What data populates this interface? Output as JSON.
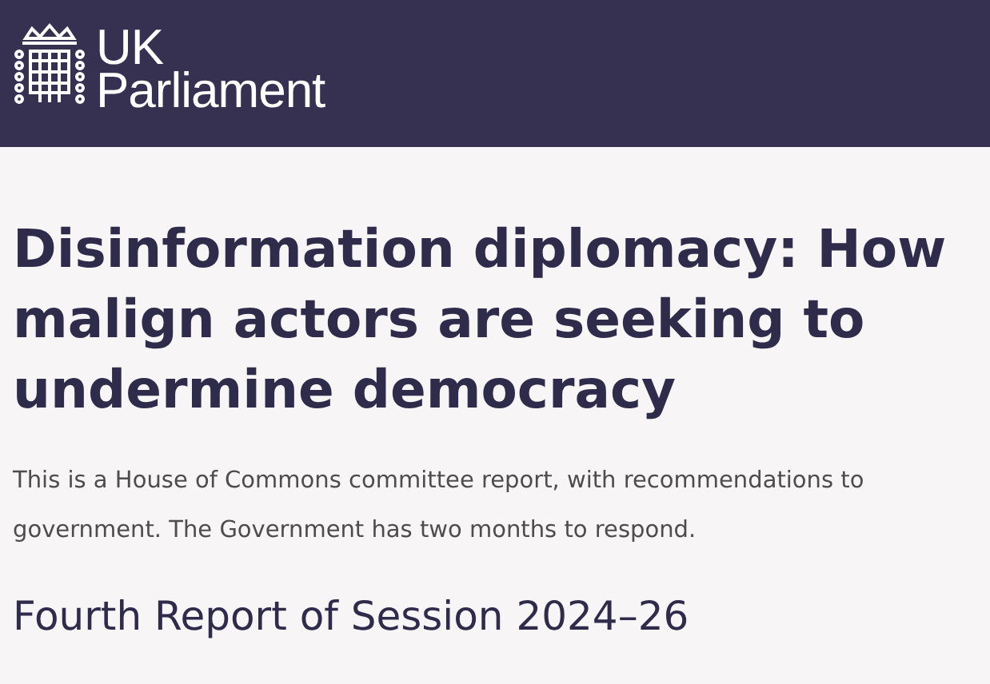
{
  "header": {
    "logo_lines": [
      "UK",
      "Parliament"
    ]
  },
  "title": "Disinformation diplomacy: How malign actors are seeking to undermine democracy",
  "summary": "This is a House of Commons committee report, with recommendations to government. The Government has two months to respond.",
  "subtitle": "Fourth Report of Session 2024–26"
}
